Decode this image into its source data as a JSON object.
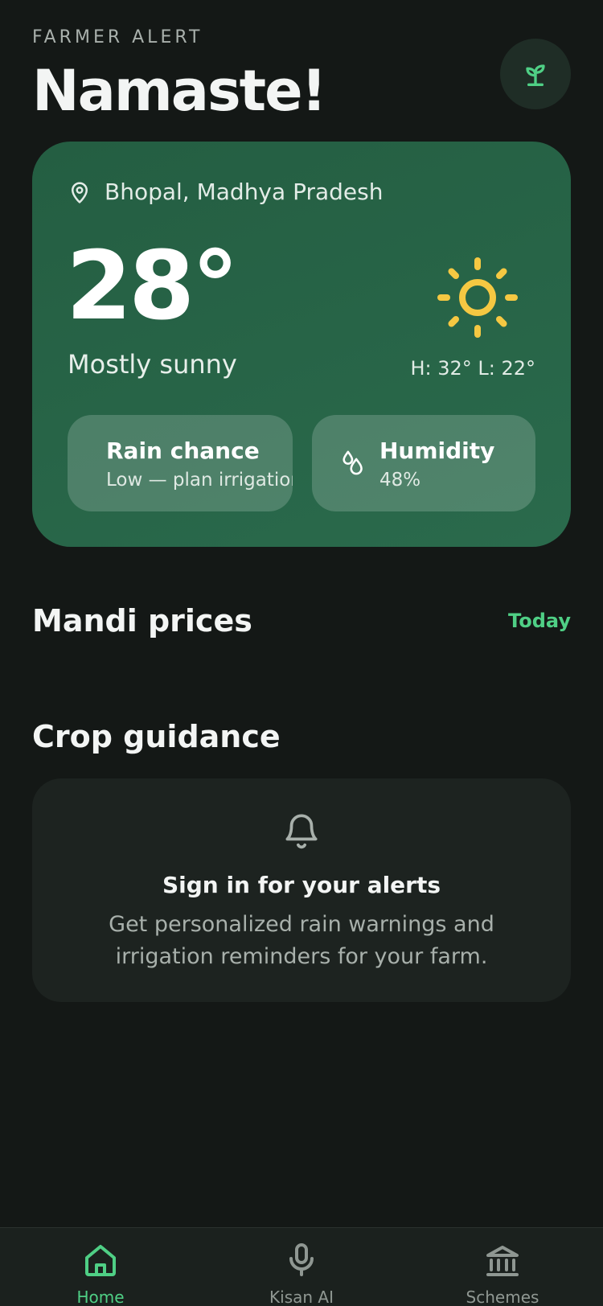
{
  "header": {
    "eyebrow": "FARMER ALERT",
    "greeting": "Namaste!",
    "avatar_icon": "sprout-icon"
  },
  "weather": {
    "location": "Bhopal, Madhya Pradesh",
    "temperature": "28°",
    "condition": "Mostly sunny",
    "high_low": "H: 32° L: 22°",
    "icon": "sun-icon",
    "rain": {
      "title": "Rain chance",
      "subtitle": "Low — plan irrigation"
    },
    "humidity": {
      "title": "Humidity",
      "value": "48%",
      "icon": "droplets-icon"
    }
  },
  "mandi": {
    "title": "Mandi prices",
    "link": "Today"
  },
  "guidance": {
    "title": "Crop guidance",
    "alert_title": "Sign in for your alerts",
    "alert_text": "Get personalized rain warnings and irrigation reminders for your farm."
  },
  "nav": {
    "items": [
      {
        "label": "Home",
        "icon": "home-icon",
        "active": true
      },
      {
        "label": "Kisan AI",
        "icon": "microphone-icon",
        "active": false
      },
      {
        "label": "Schemes",
        "icon": "bank-icon",
        "active": false
      }
    ]
  },
  "colors": {
    "background": "#141816",
    "card_green": "#245e42",
    "accent": "#4fcf85",
    "sun": "#f5c842"
  }
}
